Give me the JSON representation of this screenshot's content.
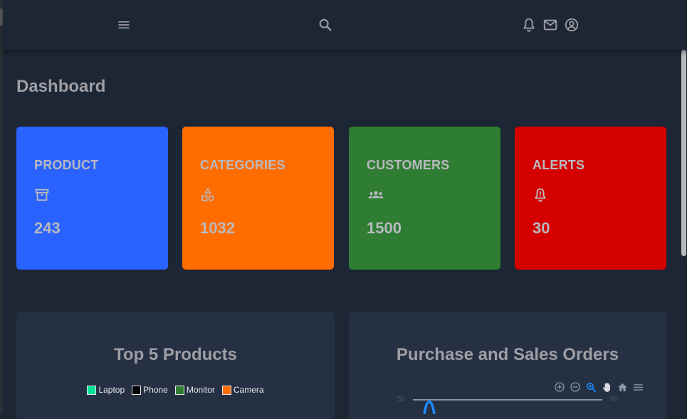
{
  "header": {
    "icons": [
      "menu-icon",
      "search-icon",
      "bell-icon",
      "mail-icon",
      "account-circle-icon"
    ]
  },
  "page": {
    "title": "Dashboard"
  },
  "cards": [
    {
      "label": "PRODUCT",
      "value": "243",
      "icon": "archive-icon",
      "color": "#2962ff"
    },
    {
      "label": "CATEGORIES",
      "value": "1032",
      "icon": "category-shapes-icon",
      "color": "#ff6d00"
    },
    {
      "label": "CUSTOMERS",
      "value": "1500",
      "icon": "people-group-icon",
      "color": "#2e7d32"
    },
    {
      "label": "ALERTS",
      "value": "30",
      "icon": "bell-alert-icon",
      "color": "#d50000"
    }
  ],
  "panels": {
    "top_products": {
      "title": "Top 5 Products",
      "legend": [
        {
          "name": "Laptop",
          "color": "#00e396"
        },
        {
          "name": "Phone",
          "color": "#000000"
        },
        {
          "name": "Monitor",
          "color": "#2e7d32"
        },
        {
          "name": "Camera",
          "color": "#ff6d00"
        }
      ]
    },
    "orders": {
      "title": "Purchase and Sales Orders",
      "toolbar_icons": [
        "zoom-in-icon",
        "zoom-out-icon",
        "selection-zoom-icon",
        "pan-hand-icon",
        "reset-home-icon",
        "hamburger-menu-icon"
      ],
      "slider_min": "55",
      "slider_max": "90",
      "accent": "#1a8cff"
    }
  }
}
